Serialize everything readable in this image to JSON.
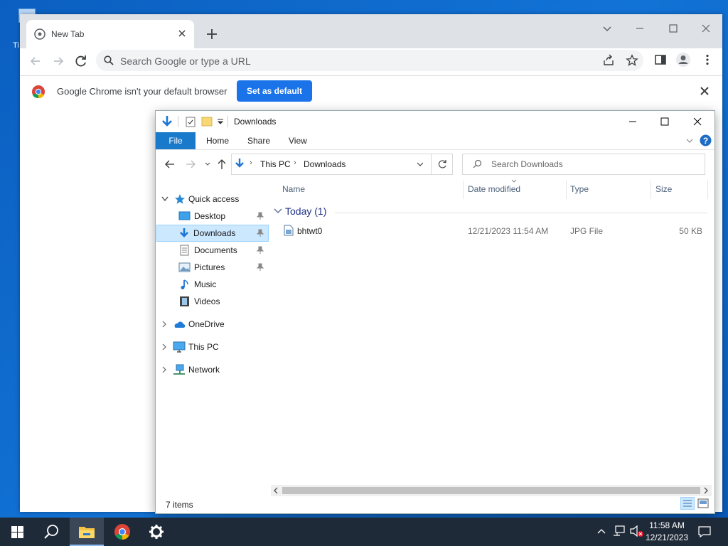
{
  "desktop": {
    "partial_label": "Ti"
  },
  "chrome": {
    "tab_title": "New Tab",
    "omnibox_placeholder": "Search Google or type a URL",
    "infobar_message": "Google Chrome isn't your default browser",
    "set_default_label": "Set as default"
  },
  "explorer": {
    "title": "Downloads",
    "ribbon_tabs": {
      "file": "File",
      "home": "Home",
      "share": "Share",
      "view": "View"
    },
    "breadcrumb": [
      "This PC",
      "Downloads"
    ],
    "search_placeholder": "Search Downloads",
    "nav": {
      "quick_access": "Quick access",
      "desktop": "Desktop",
      "downloads": "Downloads",
      "documents": "Documents",
      "pictures": "Pictures",
      "music": "Music",
      "videos": "Videos",
      "onedrive": "OneDrive",
      "this_pc": "This PC",
      "network": "Network"
    },
    "columns": {
      "name": "Name",
      "date": "Date modified",
      "type": "Type",
      "size": "Size"
    },
    "group_label": "Today (1)",
    "files": [
      {
        "name": "bhtwt0",
        "date": "12/21/2023 11:54 AM",
        "type": "JPG File",
        "size": "50 KB"
      }
    ],
    "status": "7 items"
  },
  "taskbar": {
    "time": "11:58 AM",
    "date": "12/21/2023"
  },
  "colors": {
    "accent": "#1a73e8",
    "explorer_file_tab": "#1979ca",
    "taskbar": "#1f2a38"
  }
}
